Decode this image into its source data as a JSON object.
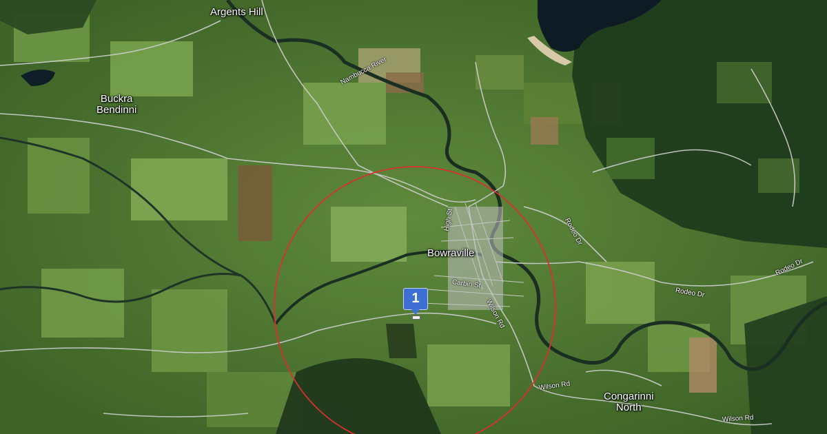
{
  "map": {
    "type": "satellite",
    "radius_circle_color": "#d93030",
    "marker_color": "#3f6fd3"
  },
  "places": {
    "argents_hill": "Argents Hill",
    "buckra_bendinni_1": "Buckra",
    "buckra_bendinni_2": "Bendinni",
    "bowraville": "Bowraville",
    "congarinni_1": "Congarinni",
    "congarinni_2": "North"
  },
  "roads": {
    "nambucca_river": "Nambucca River",
    "high_st": "High St",
    "carbin_st": "Carbin St",
    "wilson_rd_1": "Wilson Rd",
    "wilson_rd_2": "Wilson Rd",
    "wilson_rd_3": "Wilson Rd",
    "rodeo_dr_1": "Rodeo Dr",
    "rodeo_dr_2": "Rodeo Dr",
    "rodeo_dr_3": "Rodeo Dr"
  },
  "marker": {
    "label": "1"
  }
}
